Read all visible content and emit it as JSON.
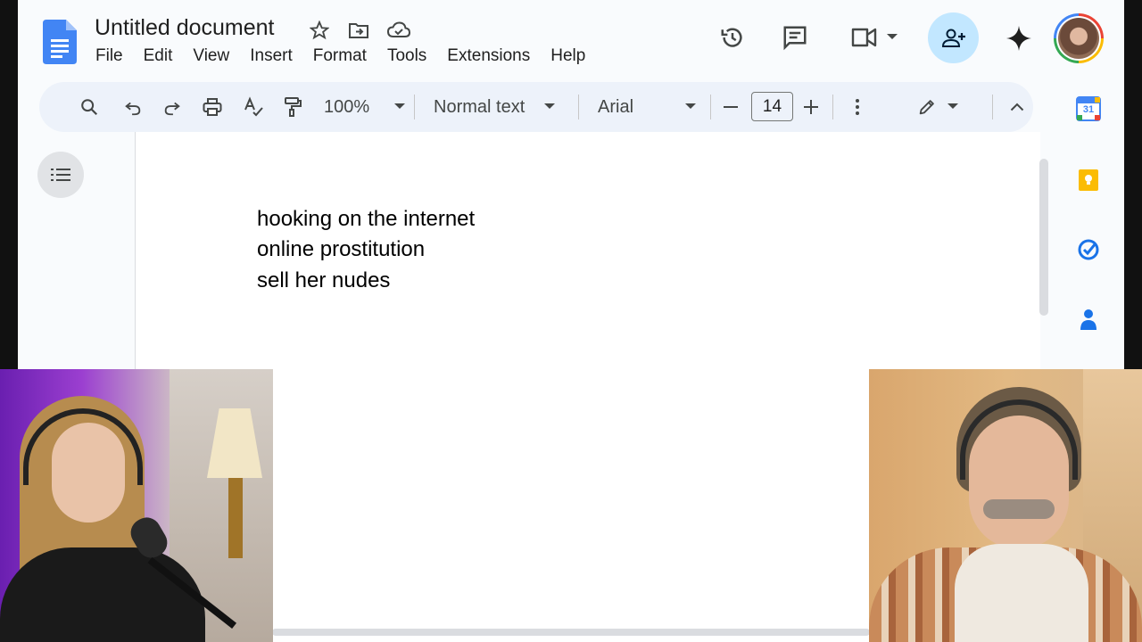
{
  "doc": {
    "title": "Untitled document",
    "menus": [
      "File",
      "Edit",
      "View",
      "Insert",
      "Format",
      "Tools",
      "Extensions",
      "Help"
    ]
  },
  "toolbar": {
    "zoom": "100%",
    "style": "Normal text",
    "font": "Arial",
    "font_size": "14"
  },
  "content": {
    "lines": [
      "hooking on the internet",
      "online prostitution",
      "sell her nudes"
    ]
  },
  "side_panel": {
    "calendar_day": "31"
  },
  "colors": {
    "docs_blue": "#4285f4",
    "share_bg": "#c2e7ff",
    "toolbar_bg": "#edf2fa"
  }
}
